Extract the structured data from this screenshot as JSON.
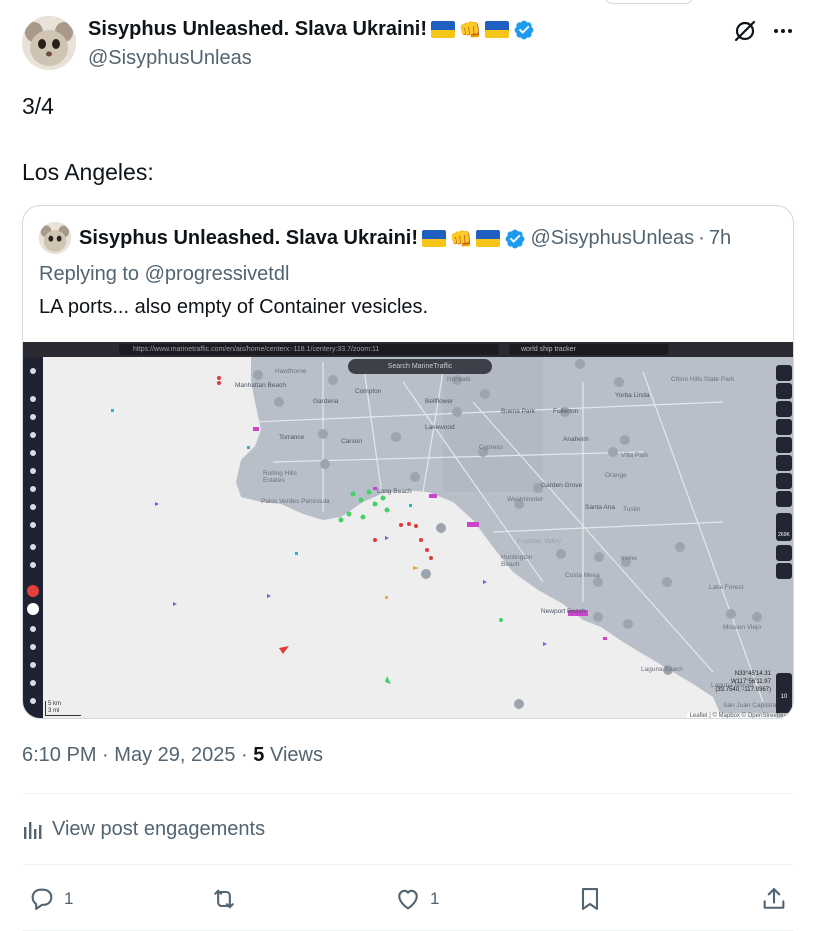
{
  "post": {
    "author_name": "Sisyphus Unleashed. Slava Ukraini!",
    "author_handle": "@SisyphusUnleas",
    "text_line1": "3/4",
    "text_line2": "Los Angeles:"
  },
  "quote": {
    "author_name": "Sisyphus Unleashed. Slava Ukraini!",
    "author_handle": "@SisyphusUnleas",
    "separator": "·",
    "time": "7h",
    "replying_prefix": "Replying to",
    "replying_to": "@progressivetdl",
    "text": "LA ports... also empty of Container vesicles.",
    "screenshot": {
      "url": "https://www.marinetraffic.com/en/ais/home/centerx:-118.1/centery:33.7/zoom:11",
      "browser_search": "world ship tracker",
      "map_search_placeholder": "Search MarineTraffic",
      "places": [
        "Hawthorne",
        "Manhattan Beach",
        "Compton",
        "Norwalk",
        "Gardena",
        "Bellflower",
        "Buena Park",
        "Fullerton",
        "Yorba Linda",
        "Chino Hills State Park",
        "Torrance",
        "Carson",
        "Lakewood",
        "Cypress",
        "Anaheim",
        "Villa Park",
        "Orange",
        "Rolling Hills Estates",
        "Palos Verdes Peninsula",
        "Long Beach",
        "Westminster",
        "Garden Grove",
        "Santa Ana",
        "Tustin",
        "Huntington Beach",
        "Fountain Valley",
        "Irvine",
        "Costa Mesa",
        "Newport Beach",
        "Lake Forest",
        "Mission Viejo",
        "Laguna Beach",
        "Laguna Niguel",
        "San Juan Capistrano"
      ],
      "scale_km": "5 km",
      "scale_mi": "3 mi",
      "coords_lat": "N33°45'14.31",
      "coords_lon": "W117°56'11.97",
      "coords_dec": "(33.7540, -117.9367)",
      "zoom_level": "10",
      "zoom_label": "269K",
      "attribution": "Leaflet | © Mapbox © OpenStreetMap"
    }
  },
  "meta": {
    "time": "6:10 PM",
    "dot": "·",
    "date": "May 29, 2025",
    "views_count": "5",
    "views_label": "Views"
  },
  "engagements_label": "View post engagements",
  "actions": {
    "replies": "1",
    "likes": "1"
  },
  "colors": {
    "verified": "#1d9bf0",
    "secondary_text": "#536471",
    "border": "#cfd9de",
    "land": "#b9bfc9",
    "sea": "#eeeeee"
  }
}
